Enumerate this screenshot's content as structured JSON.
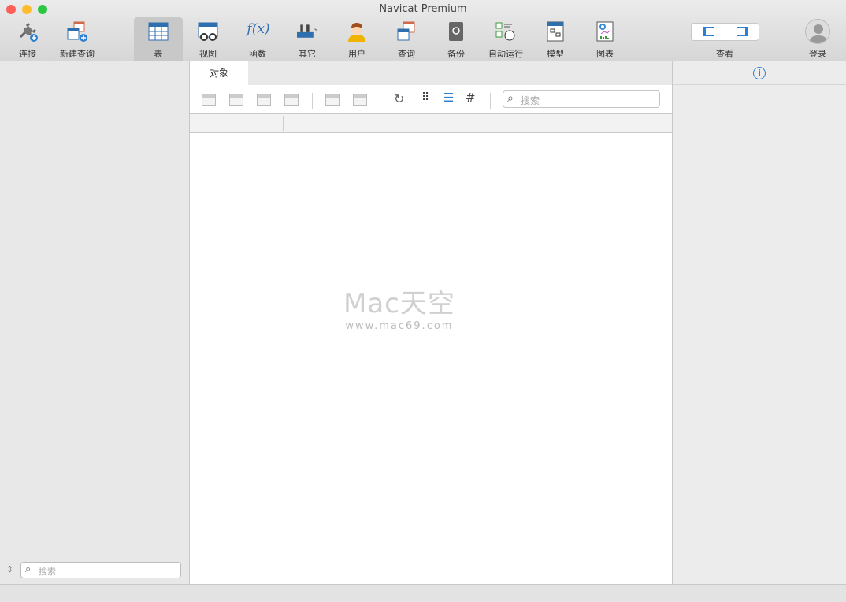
{
  "window": {
    "title": "Navicat Premium"
  },
  "toolbar": {
    "items": [
      {
        "label": "连接",
        "icon": "plug-icon"
      },
      {
        "label": "新建查询",
        "icon": "new-query-icon"
      },
      {
        "label": "表",
        "icon": "table-icon"
      },
      {
        "label": "视图",
        "icon": "view-icon"
      },
      {
        "label": "函数",
        "icon": "function-icon"
      },
      {
        "label": "其它",
        "icon": "tools-icon"
      },
      {
        "label": "用户",
        "icon": "user-icon"
      },
      {
        "label": "查询",
        "icon": "query-icon"
      },
      {
        "label": "备份",
        "icon": "backup-icon"
      },
      {
        "label": "自动运行",
        "icon": "schedule-icon"
      },
      {
        "label": "模型",
        "icon": "model-icon"
      },
      {
        "label": "图表",
        "icon": "chart-icon"
      }
    ],
    "view_label": "查看",
    "login_label": "登录",
    "function_glyph": "f(x)"
  },
  "main": {
    "tab": "对象",
    "search_placeholder": "搜索"
  },
  "sidebar": {
    "search_placeholder": "搜索"
  },
  "watermark": {
    "title": "Mac天空",
    "url": "www.mac69.com"
  },
  "colors": {
    "accent": "#2f7fd0"
  }
}
